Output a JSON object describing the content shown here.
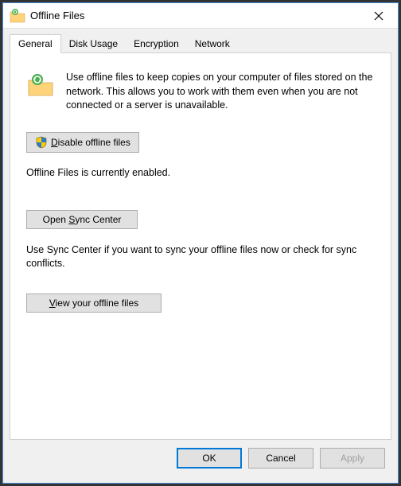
{
  "window": {
    "title": "Offline Files"
  },
  "tabs": [
    "General",
    "Disk Usage",
    "Encryption",
    "Network"
  ],
  "general": {
    "description": "Use offline files to keep copies on your computer of files stored on the network.  This allows you to work with them even when you are not connected or a server is unavailable.",
    "disable_button_prefix": "D",
    "disable_button_rest": "isable offline files",
    "status": "Offline Files is currently enabled.",
    "sync_button_prefix": "Open ",
    "sync_button_ul": "S",
    "sync_button_rest": "ync Center",
    "sync_help": "Use Sync Center if you want to sync your offline files now or check for sync conflicts.",
    "view_button_ul": "V",
    "view_button_rest": "iew your offline files"
  },
  "footer": {
    "ok": "OK",
    "cancel": "Cancel",
    "apply": "Apply"
  }
}
